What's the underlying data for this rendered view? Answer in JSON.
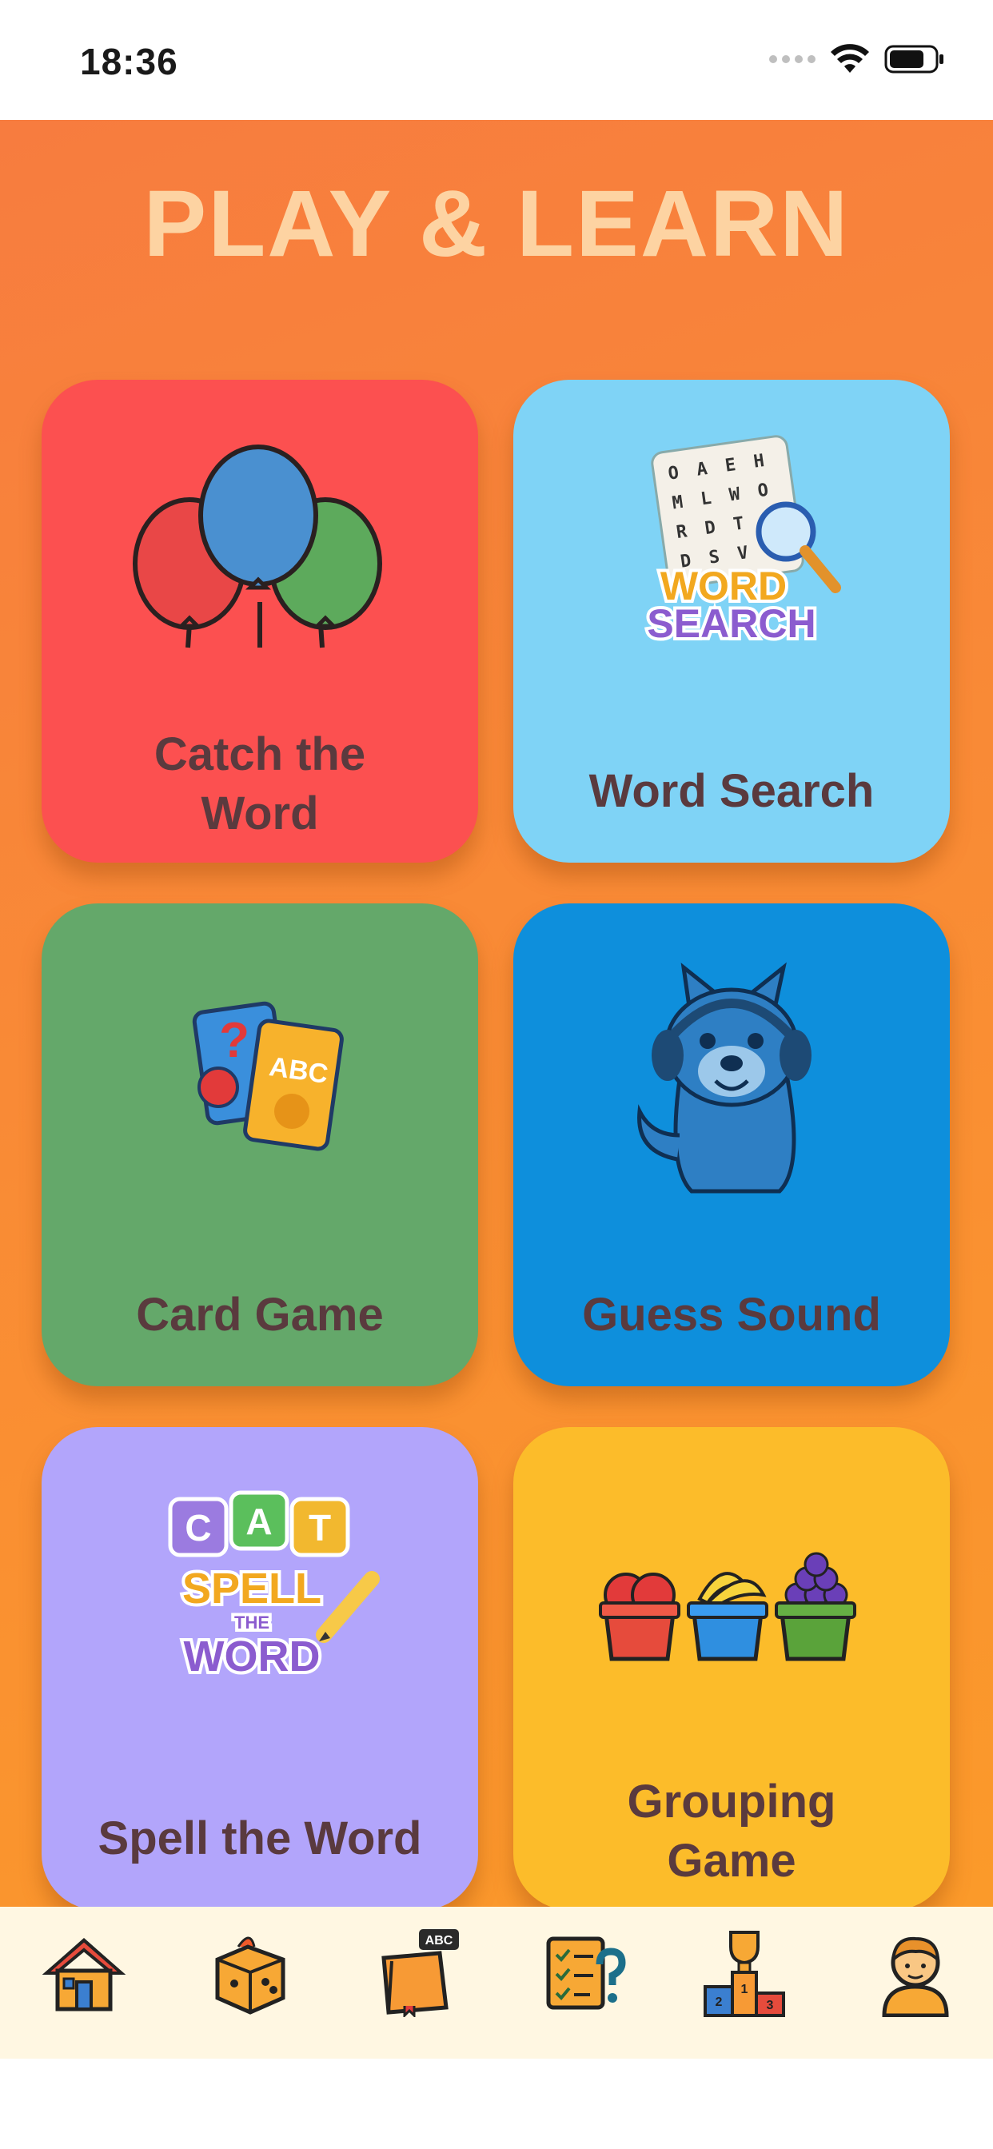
{
  "status_bar": {
    "time": "18:36"
  },
  "page_title": "PLAY & LEARN",
  "games": [
    {
      "label_lines": [
        "Catch the",
        "Word"
      ]
    },
    {
      "label_lines": [
        "Word Search"
      ],
      "art_text": [
        "WORD",
        "SEARCH"
      ],
      "grid_letters": [
        "O",
        "A",
        "E",
        "H",
        "M",
        "L",
        "W",
        "O",
        "R",
        "D",
        "T",
        "O",
        "D",
        "S",
        "V",
        "D"
      ]
    },
    {
      "label_lines": [
        "Card Game"
      ],
      "art_text": [
        "?",
        "ABC"
      ]
    },
    {
      "label_lines": [
        "Guess Sound"
      ]
    },
    {
      "label_lines": [
        "Spell the Word"
      ],
      "art_text": [
        "C",
        "A",
        "T",
        "SPELL",
        "THE",
        "WORD"
      ]
    },
    {
      "label_lines": [
        "Grouping",
        "Game"
      ]
    }
  ],
  "bottom_nav": [
    {
      "icon": "house-icon"
    },
    {
      "icon": "dice-icon"
    },
    {
      "icon": "abc-book-icon",
      "badge": "ABC"
    },
    {
      "icon": "quiz-checklist-icon"
    },
    {
      "icon": "trophy-podium-icon",
      "podium": [
        "2",
        "1",
        "3"
      ]
    },
    {
      "icon": "profile-avatar-icon"
    }
  ],
  "colors": {
    "background_top": "#f77c3f",
    "background_bottom": "#fb9a2a",
    "title": "#fdd3a2",
    "label_text": "#5a3a3e",
    "card_catch_the_word": "#fc5050",
    "card_word_search": "#7fd3f6",
    "card_card_game": "#64a86a",
    "card_guess_sound": "#0e8fdc",
    "card_spell_the_word": "#b2a5fb",
    "card_grouping_game": "#fcbc2a",
    "nav_background": "#fff7e2"
  }
}
